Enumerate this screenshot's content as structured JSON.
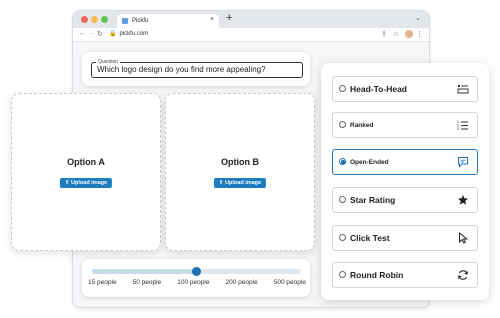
{
  "browser": {
    "tab_title": "Pickfu",
    "tab_close": "×",
    "new_tab": "+",
    "url": "pickfu.com"
  },
  "question": {
    "legend": "Question",
    "text": "Which logo design do you find more appealing?"
  },
  "options": [
    {
      "title": "Option A",
      "upload_label": "Upload image"
    },
    {
      "title": "Option B",
      "upload_label": "Upload image"
    }
  ],
  "audience_slider": {
    "labels": [
      "15 people",
      "50 people",
      "100 people",
      "200 people",
      "500 people"
    ],
    "selected_index": 2,
    "selected_fraction": 0.5
  },
  "poll_types": {
    "selected": "Open-Ended",
    "accent_color": "#1d6fae",
    "items": [
      {
        "label": "Head-To-Head",
        "icon": "list-detail-icon"
      },
      {
        "label": "Ranked",
        "icon": "numbered-list-icon"
      },
      {
        "label": "Open-Ended",
        "icon": "chat-bubble-icon"
      },
      {
        "label": "Star Rating",
        "icon": "star-icon"
      },
      {
        "label": "Click Test",
        "icon": "cursor-icon"
      },
      {
        "label": "Round Robin",
        "icon": "refresh-icon"
      }
    ]
  }
}
